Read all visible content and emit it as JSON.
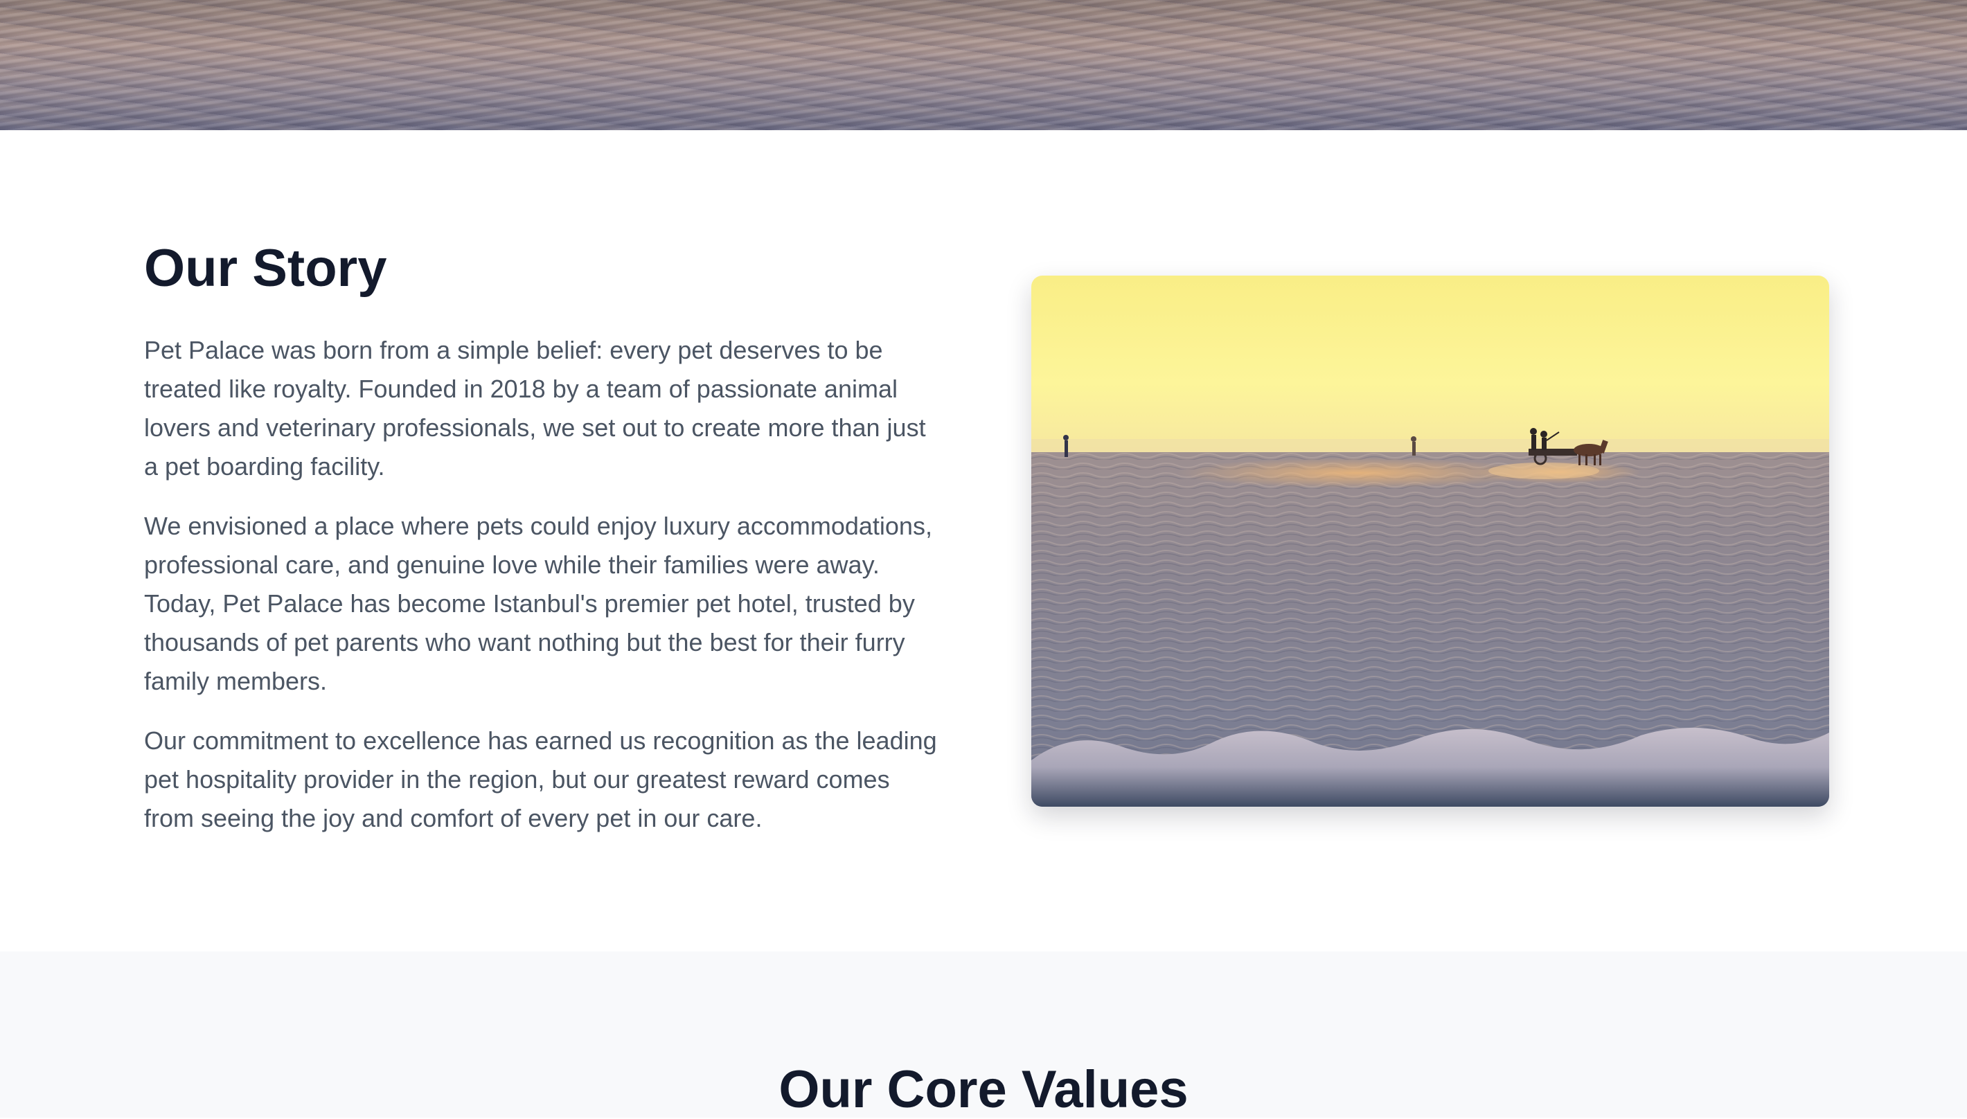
{
  "hero": {
    "image": "beach-sand-banner"
  },
  "story": {
    "title": "Our Story",
    "paragraphs": [
      "Pet Palace was born from a simple belief: every pet deserves to be treated like royalty. Founded in 2018 by a team of passionate animal lovers and veterinary professionals, we set out to create more than just a pet boarding facility.",
      "We envisioned a place where pets could enjoy luxury accommodations, professional care, and genuine love while their families were away. Today, Pet Palace has become Istanbul's premier pet hotel, trusted by thousands of pet parents who want nothing but the best for their furry family members.",
      "Our commitment to excellence has earned us recognition as the leading pet hospitality provider in the region, but our greatest reward comes from seeing the joy and comfort of every pet in our care."
    ],
    "image": "sunset-beach-horse-cart-photo"
  },
  "values": {
    "title": "Our Core Values"
  },
  "colors": {
    "heading": "#131a2c",
    "body_text": "#4b5563",
    "section_alt_bg": "#f8f9fb"
  }
}
